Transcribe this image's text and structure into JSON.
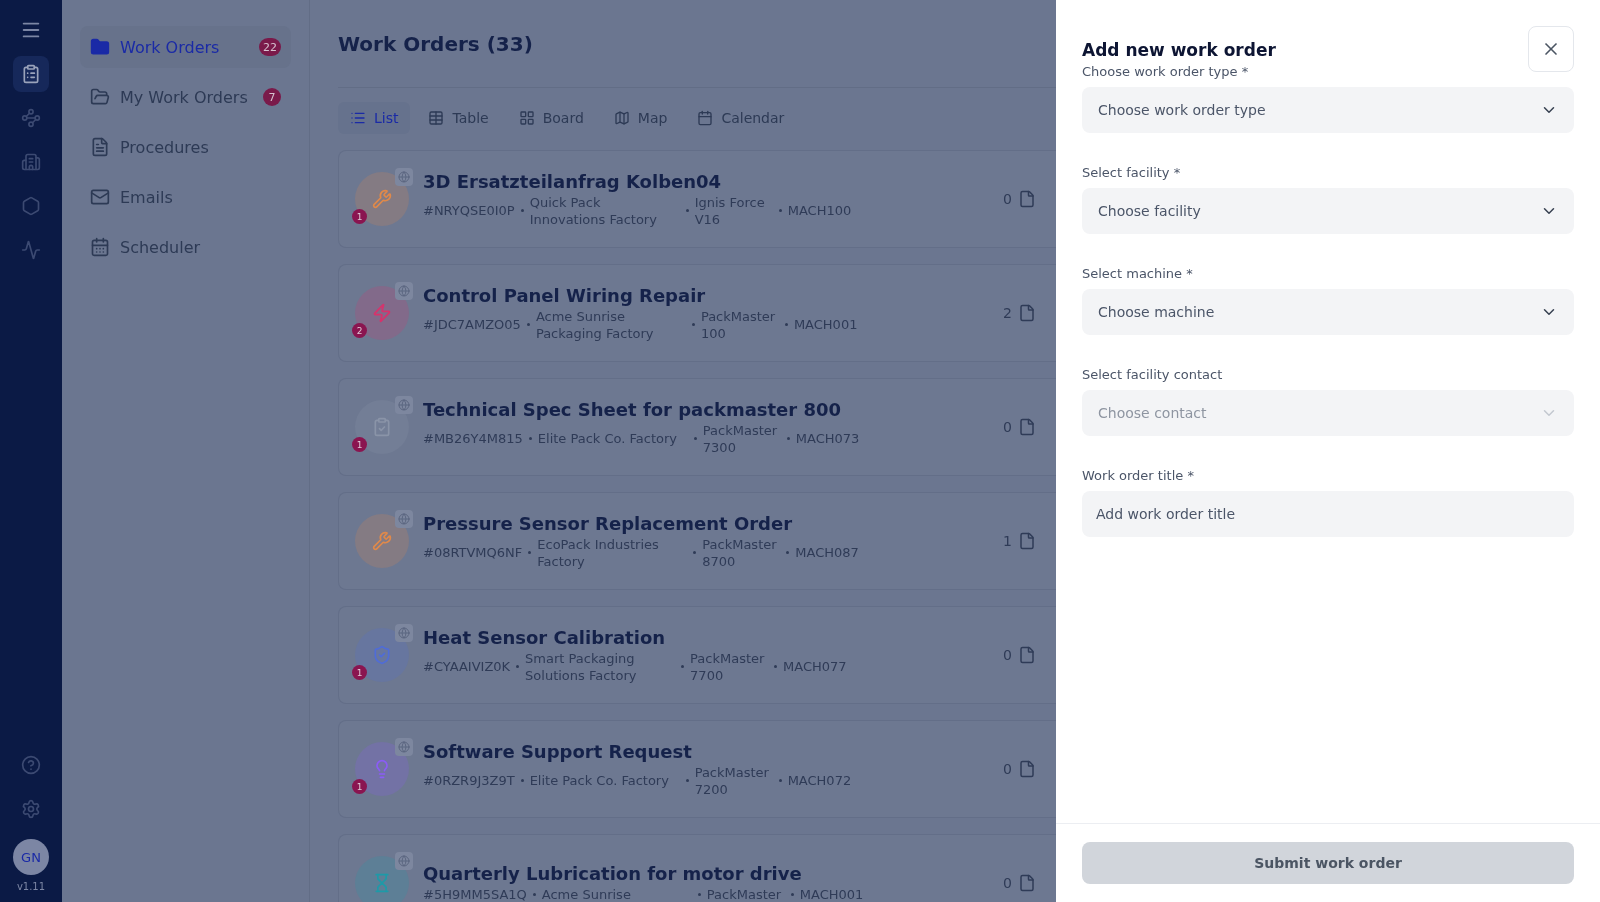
{
  "rail": {
    "version": "v1.11",
    "avatar": "GN",
    "items": [
      {
        "kind": "orders",
        "selected": true
      },
      {
        "kind": "network",
        "selected": false
      },
      {
        "kind": "buildings",
        "selected": false
      },
      {
        "kind": "threed",
        "selected": false
      },
      {
        "kind": "analytics",
        "selected": false
      }
    ]
  },
  "sidebar": {
    "items": [
      {
        "label": "Work Orders",
        "kind": "folder",
        "selected": true,
        "count": "22"
      },
      {
        "label": "My Work Orders",
        "kind": "folder-star",
        "selected": false,
        "count": "7"
      },
      {
        "label": "Procedures",
        "kind": "document",
        "selected": false
      },
      {
        "label": "Emails",
        "kind": "mail",
        "selected": false
      },
      {
        "label": "Scheduler",
        "kind": "calendar",
        "selected": false
      }
    ]
  },
  "main": {
    "title": "Work Orders (33)",
    "tabs": [
      {
        "label": "List",
        "kind": "list",
        "selected": true
      },
      {
        "label": "Table",
        "kind": "table",
        "selected": false
      },
      {
        "label": "Board",
        "kind": "board",
        "selected": false
      },
      {
        "label": "Map",
        "kind": "map",
        "selected": false
      },
      {
        "label": "Calendar",
        "kind": "calendar",
        "selected": false
      }
    ],
    "orders": [
      {
        "title": "3D Ersatzteilanfrag Kolben04",
        "code": "#NRYQSE0I0P",
        "facility": "Quick Pack Innovations Factory",
        "machine_name": "Ignis Force V16",
        "machine_id": "MACH100",
        "files": "0",
        "kind": "wrench",
        "color": "#e0894a",
        "badge": "1"
      },
      {
        "title": "Control Panel Wiring Repair",
        "code": "#JDC7AMZO05",
        "facility": "Acme Sunrise Packaging Factory",
        "machine_name": "PackMaster 100",
        "machine_id": "MACH001",
        "files": "2",
        "kind": "bolt",
        "color": "#d6336c",
        "badge": "2"
      },
      {
        "title": "Technical Spec Sheet for packmaster 800",
        "code": "#MB26Y4M815",
        "facility": "Elite Pack Co. Factory",
        "machine_name": "PackMaster 7300",
        "machine_id": "MACH073",
        "files": "0",
        "kind": "clipboard",
        "color": "#8a94a8",
        "badge": "1"
      },
      {
        "title": "Pressure Sensor Replacement Order",
        "code": "#08RTVMQ6NF",
        "facility": "EcoPack Industries Factory",
        "machine_name": "PackMaster 8700",
        "machine_id": "MACH087",
        "files": "1",
        "kind": "wrench",
        "color": "#e0894a"
      },
      {
        "title": "Heat Sensor Calibration",
        "code": "#CYAAIVIZ0K",
        "facility": "Smart Packaging Solutions Factory",
        "machine_name": "PackMaster 7700",
        "machine_id": "MACH077",
        "files": "0",
        "kind": "shield",
        "color": "#4f6cd8",
        "badge": "1"
      },
      {
        "title": "Software Support Request",
        "code": "#0RZR9J3Z9T",
        "facility": "Elite Pack Co. Factory",
        "machine_name": "PackMaster 7200",
        "machine_id": "MACH072",
        "files": "0",
        "kind": "bulb",
        "color": "#8b5cf6",
        "badge": "1"
      },
      {
        "title": "Quarterly Lubrication for motor drive",
        "code": "#5H9MM5SA1Q",
        "facility": "Acme Sunrise",
        "machine_name": "PackMaster",
        "machine_id": "MACH001",
        "files": "0",
        "kind": "hourglass",
        "color": "#1e9aa8"
      }
    ]
  },
  "drawer": {
    "title": "Add new work order",
    "fields": [
      {
        "label": "Choose work order type *",
        "kind": "select",
        "placeholder": "Choose work order type",
        "disabled": false
      },
      {
        "label": "Select facility *",
        "kind": "select",
        "placeholder": "Choose facility",
        "disabled": false
      },
      {
        "label": "Select machine *",
        "kind": "select",
        "placeholder": "Choose machine",
        "disabled": false
      },
      {
        "label": "Select facility contact",
        "kind": "select",
        "placeholder": "Choose contact",
        "disabled": true
      },
      {
        "label": "Work order title *",
        "kind": "text",
        "placeholder": "Add work order title"
      }
    ],
    "submit": {
      "label": "Submit work order",
      "disabled": true
    }
  }
}
